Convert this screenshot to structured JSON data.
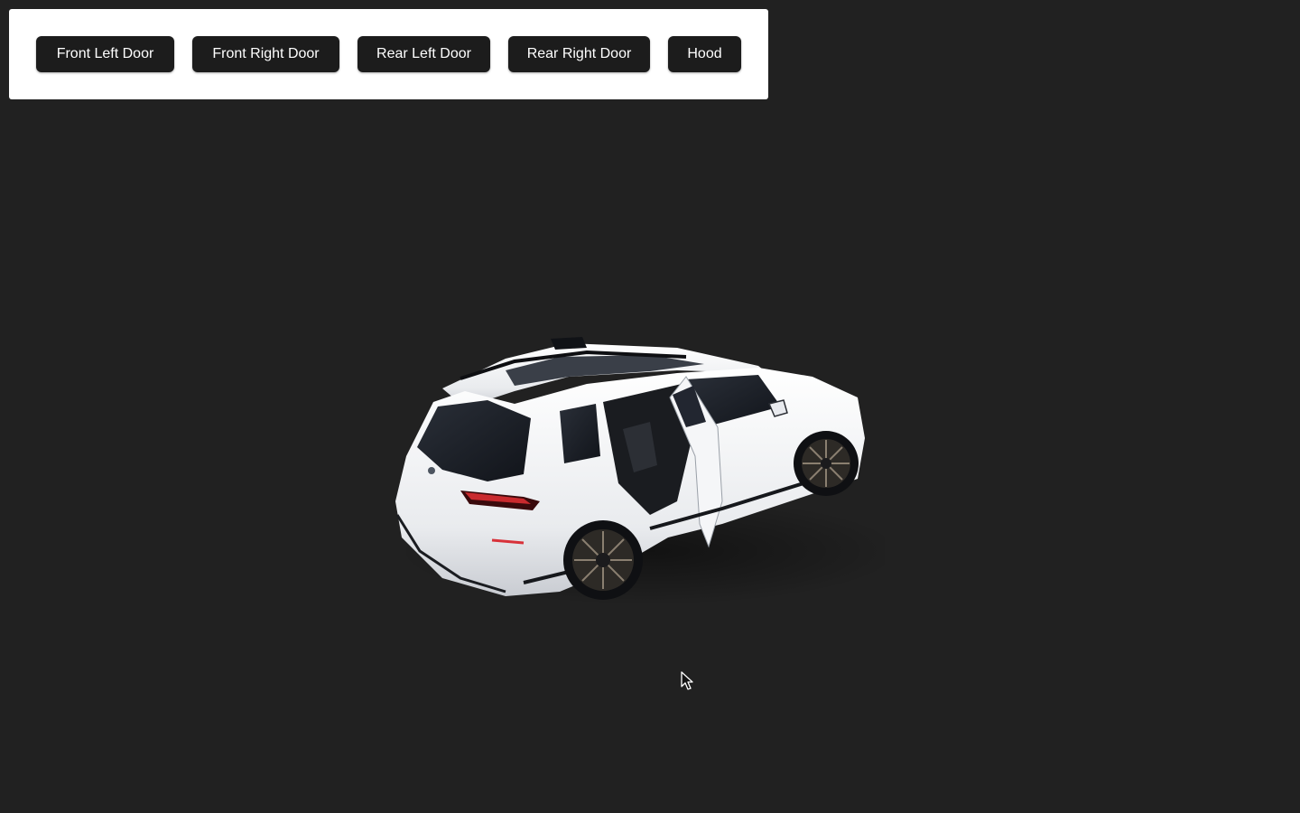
{
  "controls": {
    "buttons": [
      {
        "label": "Front Left Door"
      },
      {
        "label": "Front Right Door"
      },
      {
        "label": "Rear Left Door"
      },
      {
        "label": "Rear Right Door"
      },
      {
        "label": "Hood"
      }
    ]
  },
  "scene": {
    "background_color": "#212121",
    "car_color": "#f2f3f5",
    "object": "suv-3d-model-icon",
    "cursor": "mouse-pointer-icon"
  }
}
